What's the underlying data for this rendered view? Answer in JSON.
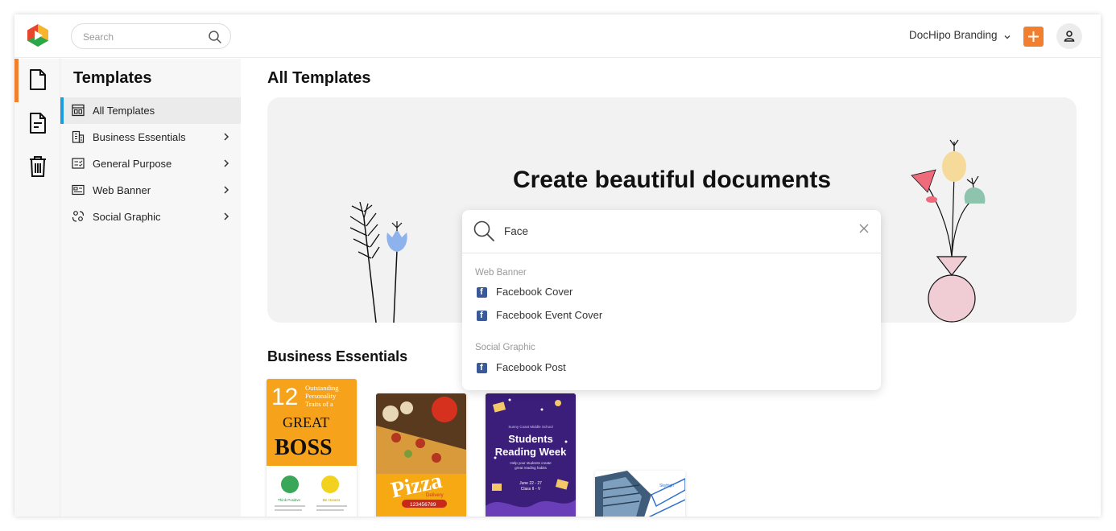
{
  "header": {
    "search_placeholder": "Search",
    "brand_label": "DocHipo Branding"
  },
  "sidebar": {
    "title": "Templates",
    "items": [
      {
        "label": "All Templates"
      },
      {
        "label": "Business Essentials"
      },
      {
        "label": "General Purpose"
      },
      {
        "label": "Web Banner"
      },
      {
        "label": "Social Graphic"
      }
    ]
  },
  "main": {
    "title": "All Templates",
    "hero_heading": "Create beautiful documents",
    "search_value": "Face",
    "suggestions": {
      "group1_label": "Web Banner",
      "group1_items": [
        "Facebook Cover",
        "Facebook Event Cover"
      ],
      "group2_label": "Social Graphic",
      "group2_items": [
        "Facebook Post"
      ]
    },
    "section_title": "Business Essentials",
    "cards": {
      "boss": {
        "number": "12",
        "line1": "Outstanding",
        "line2": "Personality",
        "line3": "Traits of a",
        "great": "GREAT",
        "boss": "BOSS",
        "trait1": "Think Positive",
        "trait2": "Be Honest"
      },
      "pizza": {
        "word": "Pizza",
        "sub": "Delivery",
        "phone": "123456789"
      },
      "reading": {
        "school": "Sunny Coast Middle School",
        "title1": "Students",
        "title2": "Reading Week",
        "sub1": "Help your students create",
        "sub2": "great reading habits",
        "date": "June 22 - 27",
        "cls": "Class II - V"
      },
      "building": {
        "brand": "Skyhigh"
      }
    }
  },
  "colors": {
    "accent_orange": "#f07f2f",
    "active_blue": "#1a9ce0",
    "facebook_blue": "#3b5998"
  }
}
